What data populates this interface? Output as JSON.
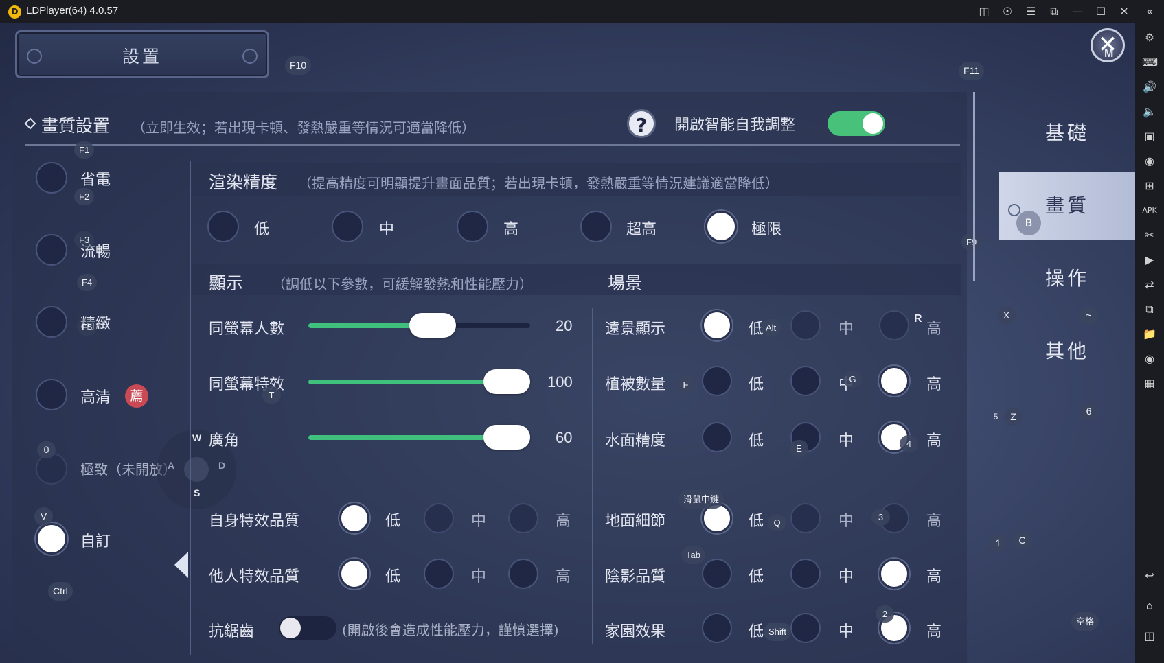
{
  "window": {
    "title": "LDPlayer(64) 4.0.57"
  },
  "titlebar_icons": [
    "gamepad-icon",
    "account-icon",
    "menu-icon",
    "popout-icon",
    "minimize-icon",
    "maximize-icon",
    "close-icon",
    "collapse-icon"
  ],
  "game": {
    "settings_title": "設置",
    "quality_section": {
      "title": "畫質設置",
      "note": "（立即生效；若出現卡頓、發熱嚴重等情況可適當降低）",
      "auto_adjust_label": "開啟智能自我調整",
      "auto_adjust_on": true
    },
    "presets": [
      {
        "label": "省電",
        "selected": false
      },
      {
        "label": "流暢",
        "selected": false
      },
      {
        "label": "精緻",
        "selected": false
      },
      {
        "label": "高清",
        "selected": false,
        "badge": "薦"
      },
      {
        "label": "極致（未開放）",
        "selected": false
      },
      {
        "label": "自訂",
        "selected": true
      }
    ],
    "render": {
      "title": "渲染精度",
      "note": "（提高精度可明顯提升畫面品質；若出現卡頓，發熱嚴重等情況建議適當降低）",
      "options": [
        "低",
        "中",
        "高",
        "超高",
        "極限"
      ],
      "selected": "極限"
    },
    "display": {
      "title": "顯示",
      "note": "（調低以下參數，可緩解發熱和性能壓力）",
      "sliders": [
        {
          "label": "同螢幕人數",
          "value": 20,
          "fraction": 0.56
        },
        {
          "label": "同螢幕特效",
          "value": 100,
          "fraction": 1.0
        },
        {
          "label": "廣角",
          "value": 60,
          "fraction": 1.0
        }
      ],
      "self_effect": {
        "label": "自身特效品質",
        "options": [
          "低",
          "中",
          "高"
        ],
        "selected": "低"
      },
      "other_effect": {
        "label": "他人特效品質",
        "options": [
          "低",
          "中",
          "高"
        ],
        "selected": "低"
      },
      "antialias": {
        "label": "抗鋸齒",
        "note": "(開啟後會造成性能壓力，謹慎選擇)",
        "on": false
      }
    },
    "scene": {
      "title": "場景",
      "rows": [
        {
          "label": "遠景顯示",
          "options": [
            "低",
            "中",
            "高"
          ],
          "selected": "低"
        },
        {
          "label": "植被數量",
          "options": [
            "低",
            "中",
            "高"
          ],
          "selected": "高"
        },
        {
          "label": "水面精度",
          "options": [
            "低",
            "中",
            "高"
          ],
          "selected": "高"
        },
        {
          "label": "地面細節",
          "options": [
            "低",
            "中",
            "高"
          ],
          "selected": "低"
        },
        {
          "label": "陰影品質",
          "options": [
            "低",
            "中",
            "高"
          ],
          "selected": "高"
        },
        {
          "label": "家園效果",
          "options": [
            "低",
            "中",
            "高"
          ],
          "selected": "高"
        }
      ]
    },
    "nav": {
      "items": [
        "基礎",
        "畫質",
        "操作",
        "其他"
      ],
      "active": "畫質"
    },
    "keys": {
      "f10": "F10",
      "f11": "F11",
      "f9": "F9",
      "f1": "F1",
      "f2": "F2",
      "f3": "F3",
      "f4": "F4",
      "f5": "F5",
      "zero": "0",
      "v": "V",
      "ctrl": "Ctrl",
      "t": "T",
      "w": "W",
      "a": "A",
      "s": "S",
      "d": "D",
      "alt": "Alt",
      "r": "R",
      "f": "F",
      "g": "G",
      "e": "E",
      "four": "4",
      "mouse_mid": "滑鼠中鍵",
      "q": "Q",
      "tab": "Tab",
      "three": "3",
      "shift": "Shift",
      "two": "2",
      "x": "X",
      "tilde": "~",
      "b": "B",
      "m": "M",
      "five": "5",
      "z": "Z",
      "six": "6",
      "one": "1",
      "c": "C",
      "space": "空格"
    }
  },
  "right_toolbar_icons": [
    "settings-icon",
    "keyboard-icon",
    "volume-up-icon",
    "volume-down-icon",
    "screenshot-icon",
    "record-icon",
    "add-app-icon",
    "apk-icon",
    "scissors-icon",
    "video-icon",
    "sync-icon",
    "multi-instance-icon",
    "folder-icon",
    "location-icon",
    "shake-icon",
    "back-icon",
    "home-icon",
    "recent-apps-icon"
  ]
}
